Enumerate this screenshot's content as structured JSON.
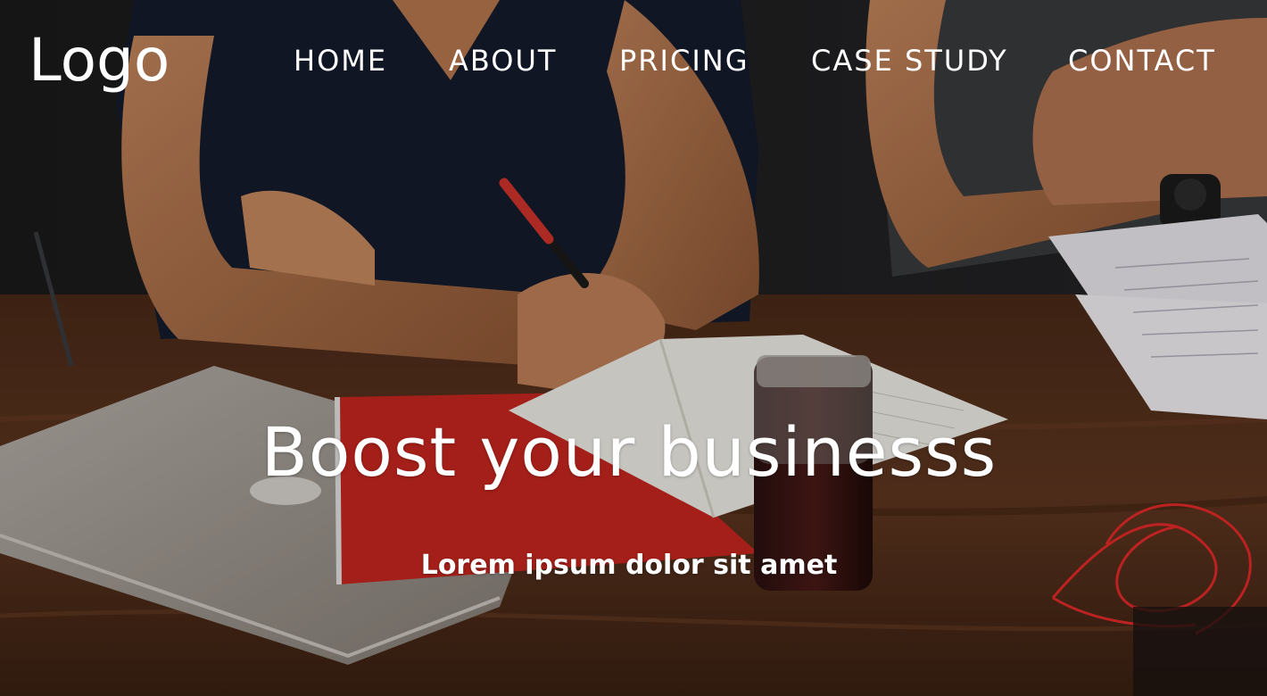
{
  "header": {
    "logo": "Logo",
    "nav": {
      "home": "HOME",
      "about": "ABOUT",
      "pricing": "PRICING",
      "case_study": "CASE STUDY",
      "contact": "CONTACT"
    }
  },
  "hero": {
    "headline": "Boost your businesss",
    "subheadline": "Lorem ipsum dolor sit amet"
  },
  "colors": {
    "text": "#ffffff",
    "table_wood": "#5a341f",
    "notebook_red": "#c8261f",
    "shirt_navy": "#141b2c"
  },
  "background_icons": [
    "laptop-icon",
    "notebook-icon",
    "pencil-icon",
    "jar-icon",
    "earphones-icon",
    "watch-icon"
  ]
}
